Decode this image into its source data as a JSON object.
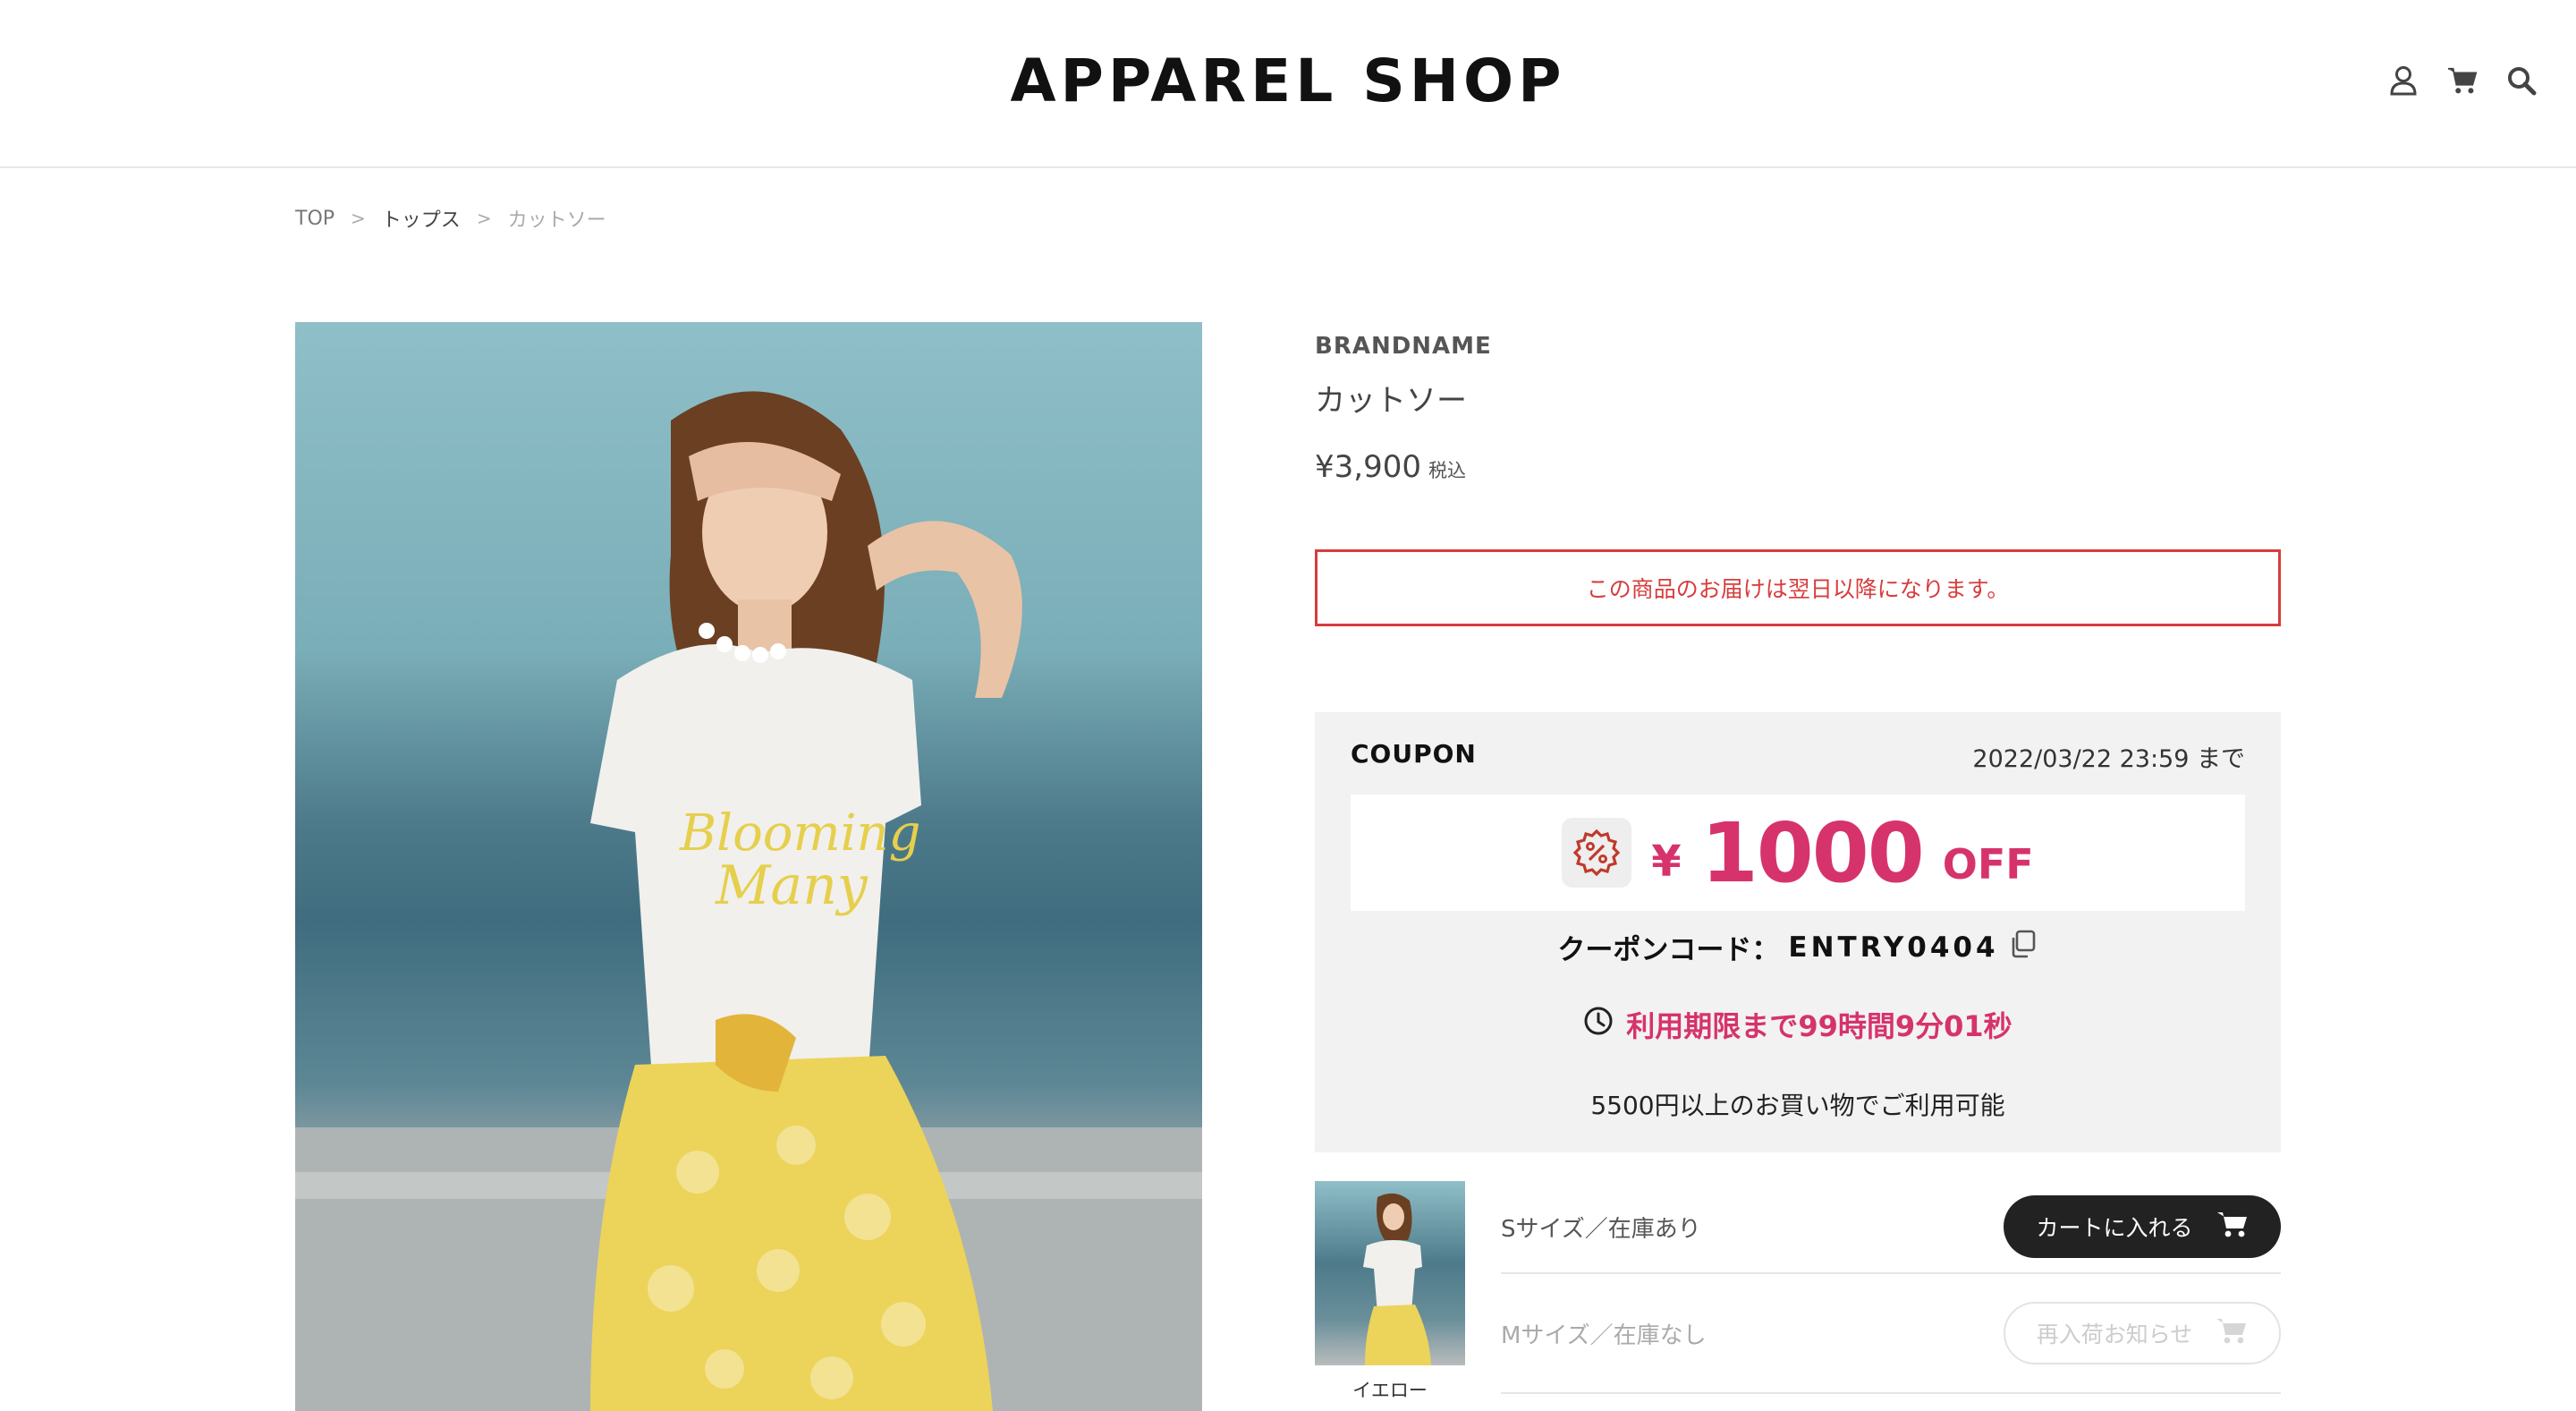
{
  "header": {
    "logo": "APPAREL SHOP",
    "icons": [
      "user-icon",
      "cart-icon",
      "search-icon"
    ]
  },
  "breadcrumb": {
    "items": [
      "TOP",
      "トップス",
      "カットソー"
    ],
    "separator": ">"
  },
  "product": {
    "brand": "BRANDNAME",
    "name": "カットソー",
    "price": "¥3,900",
    "tax_label": "税込",
    "delivery_notice": "この商品のお届けは翌日以降になります。"
  },
  "coupon": {
    "label": "COUPON",
    "expiry": "2022/03/22 23:59 まで",
    "currency": "¥",
    "amount": "1000",
    "off": "OFF",
    "code_label": "クーポンコード：",
    "code": "ENTRY0404",
    "timer_prefix": "利用期限まで",
    "timer_hours": "99",
    "timer_hours_unit": "時間",
    "timer_minutes": "9",
    "timer_minutes_unit": "分",
    "timer_seconds": "01",
    "timer_seconds_unit": "秒",
    "minimum": "5500円以上のお買い物でご利用可能"
  },
  "variants": {
    "color_label": "イエロー",
    "rows": [
      {
        "label": "Sサイズ／在庫あり",
        "button": "カートに入れる"
      },
      {
        "label": "Mサイズ／在庫なし",
        "button": "再入荷お知らせ"
      }
    ]
  },
  "colors": {
    "accent_pink": "#d6336c",
    "notice_red": "#d83c3c",
    "dark_button": "#222222"
  }
}
